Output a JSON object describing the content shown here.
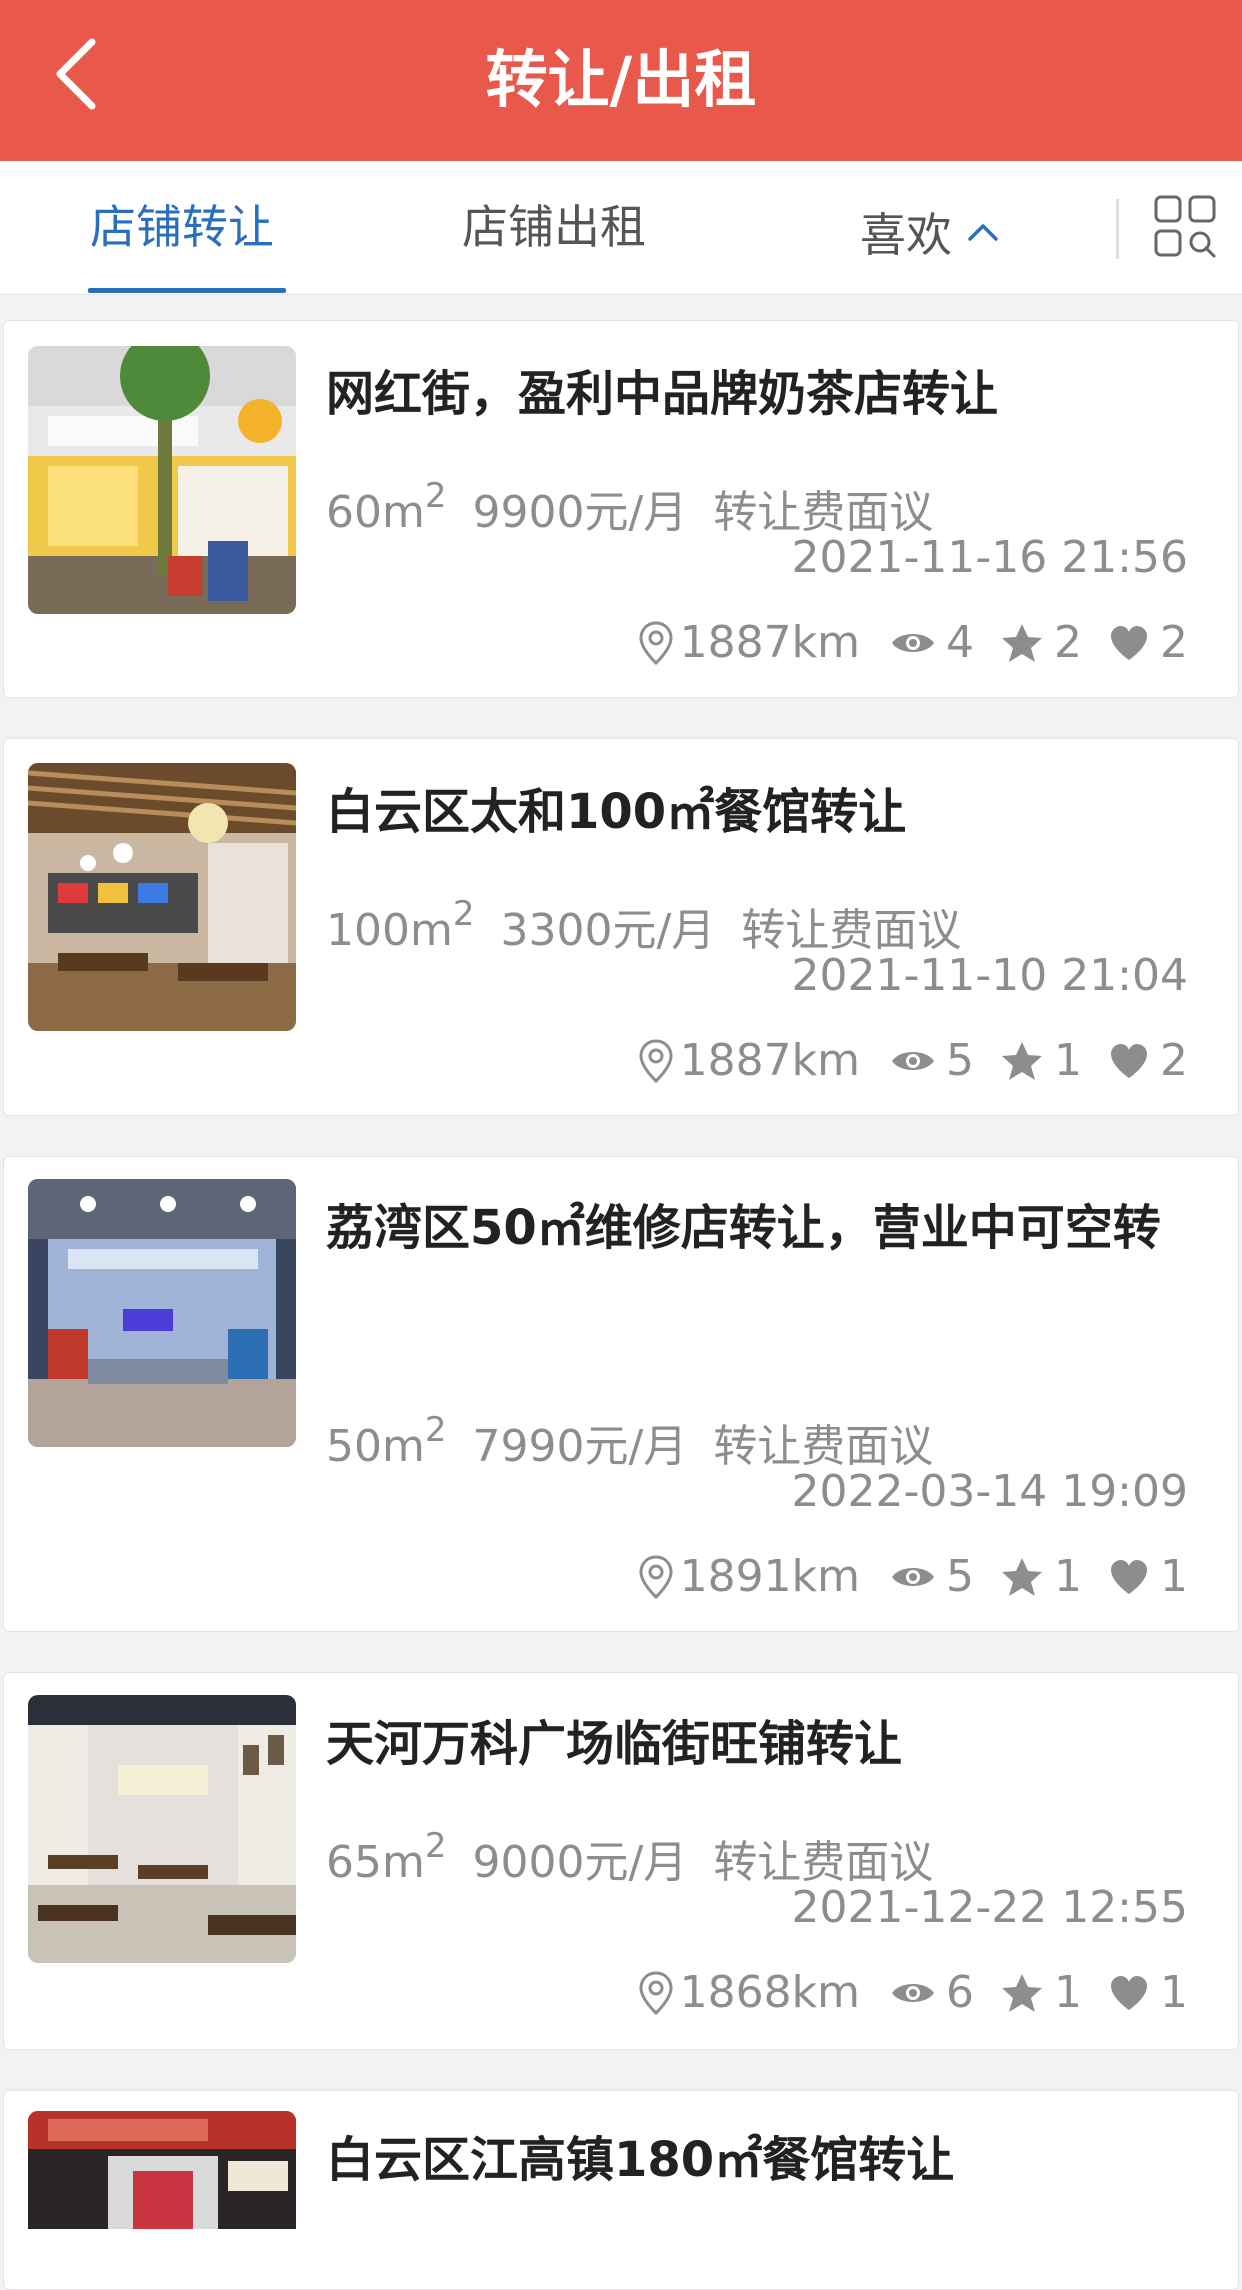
{
  "header": {
    "title": "转让/出租",
    "back_icon": "chevron-left-icon",
    "background": "#e9594b"
  },
  "tabs": [
    {
      "label": "店铺转让",
      "active": true
    },
    {
      "label": "店铺出租",
      "active": false
    },
    {
      "label": "喜欢",
      "active": false,
      "icon": "chevron-up-icon"
    }
  ],
  "tab_accent": "#2a6fbe",
  "grid_toggle_icon": "grid-view-icon",
  "listings": [
    {
      "title": "网红街，盈利中品牌奶茶店转让",
      "area": "60m",
      "area_sup": "2",
      "rent": "9900元/月",
      "fee": "转让费面议",
      "date": "2021-11-16 21:56",
      "distance": "1887km",
      "views": "4",
      "stars": "2",
      "likes": "2",
      "thumb": "milk-tea-shop-photo"
    },
    {
      "title": "白云区太和100㎡餐馆转让",
      "area": "100m",
      "area_sup": "2",
      "rent": "3300元/月",
      "fee": "转让费面议",
      "date": "2021-11-10 21:04",
      "distance": "1887km",
      "views": "5",
      "stars": "1",
      "likes": "2",
      "thumb": "restaurant-interior-photo"
    },
    {
      "title": "荔湾区50㎡维修店转让，营业中可空转",
      "area": "50m",
      "area_sup": "2",
      "rent": "7990元/月",
      "fee": "转让费面议",
      "date": "2022-03-14 19:09",
      "distance": "1891km",
      "views": "5",
      "stars": "1",
      "likes": "1",
      "thumb": "repair-shop-photo"
    },
    {
      "title": "天河万科广场临街旺铺转让",
      "area": "65m",
      "area_sup": "2",
      "rent": "9000元/月",
      "fee": "转让费面议",
      "date": "2021-12-22 12:55",
      "distance": "1868km",
      "views": "6",
      "stars": "1",
      "likes": "1",
      "thumb": "dining-hall-photo"
    },
    {
      "title": "白云区江高镇180㎡餐馆转让",
      "thumb": "crayfish-restaurant-photo"
    }
  ]
}
